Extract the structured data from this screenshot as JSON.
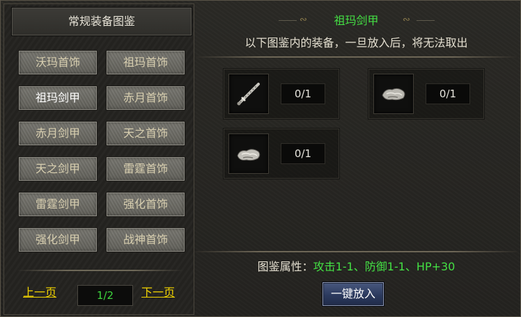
{
  "left_panel": {
    "title": "常规装备图鉴",
    "categories": [
      "沃玛首饰",
      "祖玛首饰",
      "祖玛剑甲",
      "赤月首饰",
      "赤月剑甲",
      "天之首饰",
      "天之剑甲",
      "雷霆首饰",
      "雷霆剑甲",
      "强化首饰",
      "强化剑甲",
      "战神首饰"
    ],
    "selected_index": 2,
    "pager": {
      "prev_label": "上一页",
      "page_text": "1/2",
      "next_label": "下一页"
    }
  },
  "right_panel": {
    "item_title": "祖玛剑甲",
    "notice": "以下图鉴内的装备，一旦放入后，将无法取出",
    "slots": [
      {
        "icon": "sword-icon",
        "count": "0/1"
      },
      {
        "icon": "armor-icon",
        "count": "0/1"
      },
      {
        "icon": "armor-icon",
        "count": "0/1"
      }
    ],
    "attributes": {
      "label": "图鉴属性：",
      "value": "攻击1-1、防御1-1、HP+30"
    },
    "put_all_label": "一键放入"
  },
  "colors": {
    "accent_green": "#44e044",
    "link_yellow": "#f2d400",
    "button_blue": "#2c3a5e",
    "text_light": "#e4dfd0"
  }
}
